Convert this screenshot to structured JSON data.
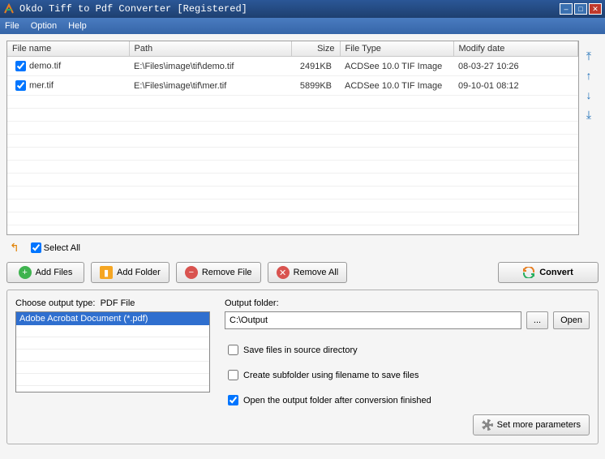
{
  "title": "Okdo Tiff to Pdf Converter [Registered]",
  "menu": {
    "file": "File",
    "option": "Option",
    "help": "Help"
  },
  "columns": {
    "name": "File name",
    "path": "Path",
    "size": "Size",
    "type": "File Type",
    "date": "Modify date"
  },
  "files": [
    {
      "name": "demo.tif",
      "path": "E:\\Files\\image\\tif\\demo.tif",
      "size": "2491KB",
      "type": "ACDSee 10.0 TIF Image",
      "date": "08-03-27 10:26"
    },
    {
      "name": "mer.tif",
      "path": "E:\\Files\\image\\tif\\mer.tif",
      "size": "5899KB",
      "type": "ACDSee 10.0 TIF Image",
      "date": "09-10-01 08:12"
    }
  ],
  "select_all": "Select All",
  "buttons": {
    "add_files": "Add Files",
    "add_folder": "Add Folder",
    "remove_file": "Remove File",
    "remove_all": "Remove All",
    "convert": "Convert"
  },
  "output_type": {
    "label": "Choose output type:",
    "current": "PDF File",
    "option": "Adobe Acrobat Document (*.pdf)"
  },
  "output_folder": {
    "label": "Output folder:",
    "value": "C:\\Output",
    "browse": "...",
    "open": "Open"
  },
  "checks": {
    "save_source": "Save files in source directory",
    "subfolder": "Create subfolder using filename to save files",
    "open_after": "Open the output folder after conversion finished"
  },
  "more_params": "Set more parameters"
}
